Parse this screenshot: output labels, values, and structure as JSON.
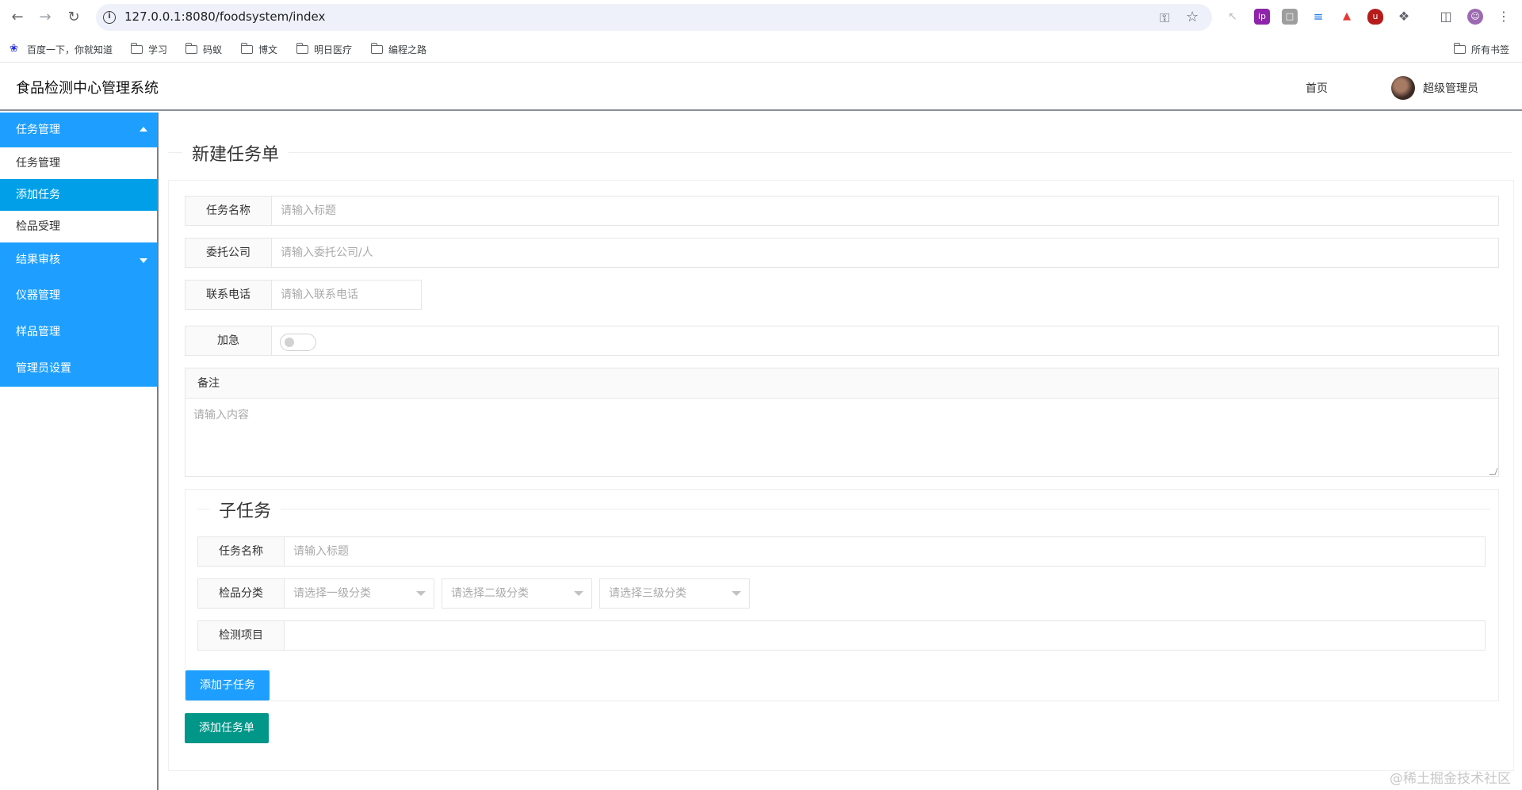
{
  "browser": {
    "url": "127.0.0.1:8080/foodsystem/index",
    "bookmarks": [
      "百度一下，你就知道",
      "学习",
      "码蚁",
      "博文",
      "明日医疗",
      "编程之路"
    ],
    "all_bookmarks": "所有书签"
  },
  "header": {
    "title": "食品检测中心管理系统",
    "home_link": "首页",
    "user_name": "超级管理员"
  },
  "sidebar": {
    "group_task": "任务管理",
    "sub_items": [
      "任务管理",
      "添加任务",
      "检品受理"
    ],
    "group_review": "结果审核",
    "items": [
      "仪器管理",
      "样品管理",
      "管理员设置"
    ]
  },
  "form": {
    "legend": "新建任务单",
    "task_name_label": "任务名称",
    "task_name_placeholder": "请输入标题",
    "company_label": "委托公司",
    "company_placeholder": "请输入委托公司/人",
    "phone_label": "联系电话",
    "phone_placeholder": "请输入联系电话",
    "urgent_label": "加急",
    "urgent_on": false,
    "remark_label": "备注",
    "remark_placeholder": "请输入内容"
  },
  "subtask": {
    "legend": "子任务",
    "name_label": "任务名称",
    "name_placeholder": "请输入标题",
    "category_label": "检品分类",
    "cat1_placeholder": "请选择一级分类",
    "cat2_placeholder": "请选择二级分类",
    "cat3_placeholder": "请选择三级分类",
    "item_label": "检测项目",
    "add_sub_button": "添加子任务"
  },
  "submit_button": "添加任务单",
  "watermark": "@稀土掘金技术社区",
  "colors": {
    "primary": "#1e9fff",
    "active": "#009fe8",
    "success": "#009688"
  }
}
